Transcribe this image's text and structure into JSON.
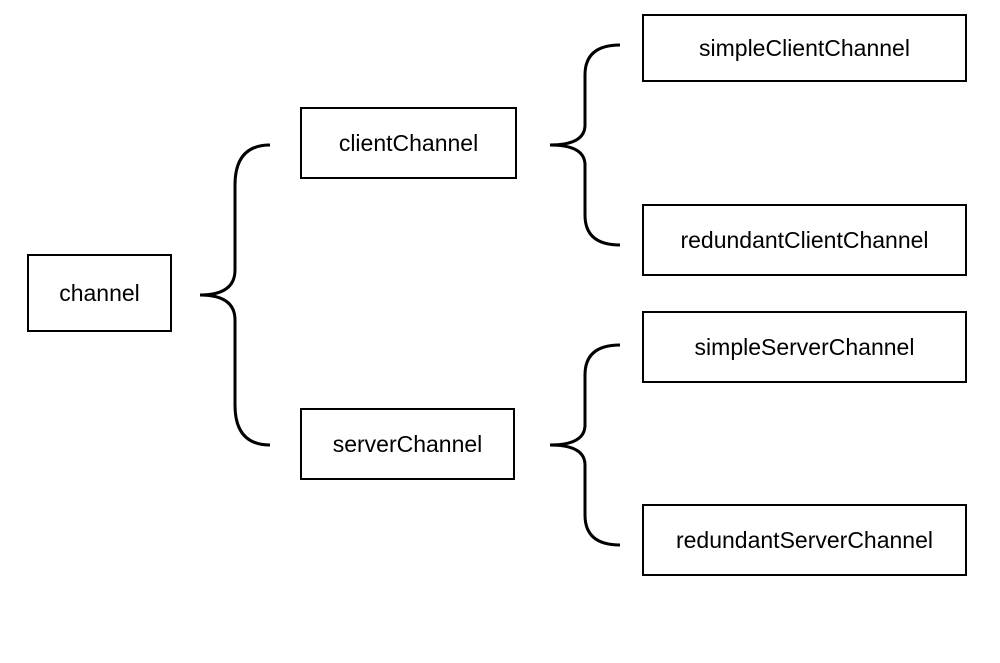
{
  "root": {
    "label": "channel"
  },
  "level2": {
    "client": {
      "label": "clientChannel"
    },
    "server": {
      "label": "serverChannel"
    }
  },
  "level3": {
    "simpleClient": {
      "label": "simpleClientChannel"
    },
    "redundantClient": {
      "label": "redundantClientChannel"
    },
    "simpleServer": {
      "label": "simpleServerChannel"
    },
    "redundantServer": {
      "label": "redundantServerChannel"
    }
  }
}
